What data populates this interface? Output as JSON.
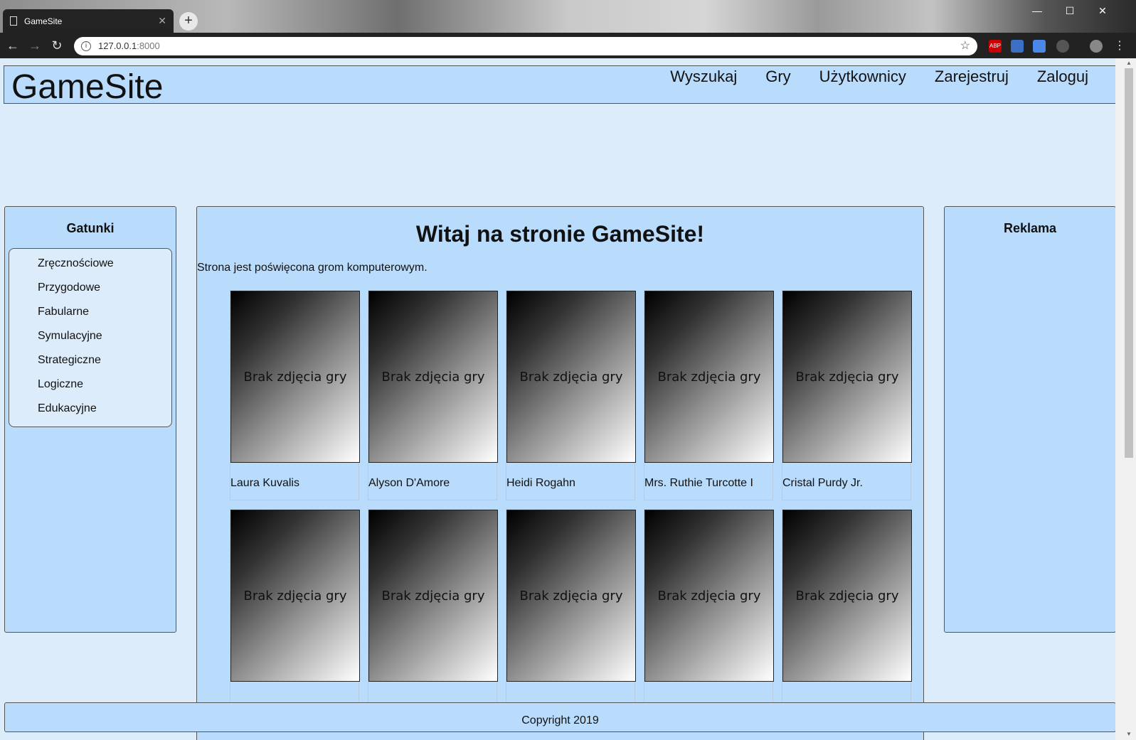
{
  "browser": {
    "tab_title": "GameSite",
    "url_host": "127.0.0.1",
    "url_port": ":8000"
  },
  "site": {
    "logo": "GameSite",
    "nav": [
      "Wyszukaj",
      "Gry",
      "Użytkownicy",
      "Zarejestruj",
      "Zaloguj"
    ]
  },
  "genres": {
    "title": "Gatunki",
    "items": [
      "Zręcznościowe",
      "Przygodowe",
      "Fabularne",
      "Symulacyjne",
      "Strategiczne",
      "Logiczne",
      "Edukacyjne"
    ]
  },
  "main": {
    "heading": "Witaj na stronie GameSite!",
    "intro": "Strona jest poświęcona grom komputerowym.",
    "no_image_text": "Brak zdjęcia gry",
    "games": [
      "Laura Kuvalis",
      "Alyson D'Amore",
      "Heidi Rogahn",
      "Mrs. Ruthie Turcotte I",
      "Cristal Purdy Jr."
    ]
  },
  "ads": {
    "title": "Reklama"
  },
  "footer": {
    "copyright": "Copyright 2019"
  }
}
